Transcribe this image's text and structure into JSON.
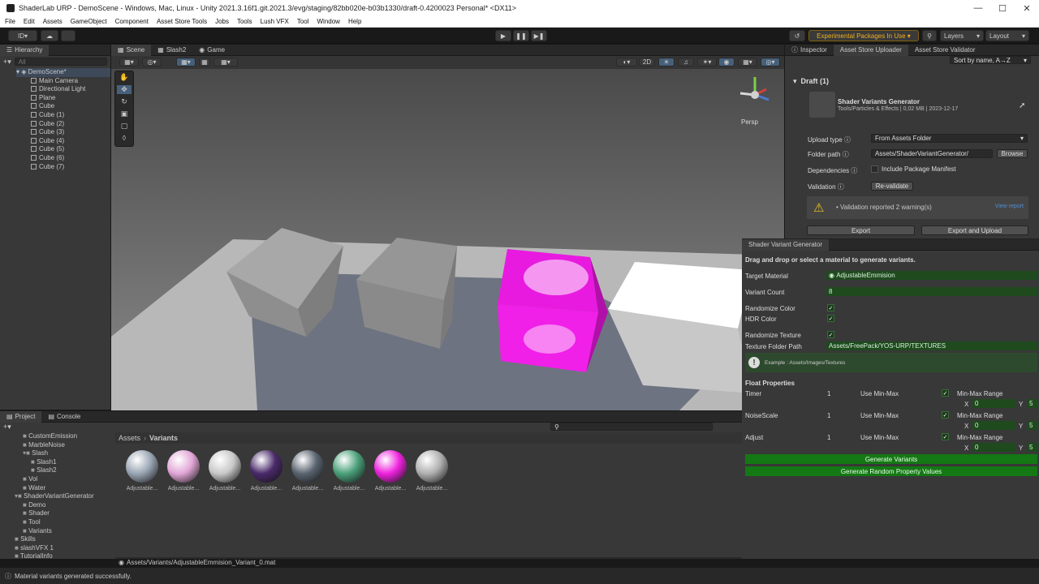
{
  "window": {
    "title": "ShaderLab URP - DemoScene - Windows, Mac, Linux - Unity 2021.3.16f1.git.2021.3/evg/staging/82bb020e-b03b1330/draft-0.4200023 Personal* <DX11>"
  },
  "menu": [
    "File",
    "Edit",
    "Assets",
    "GameObject",
    "Component",
    "Asset Store Tools",
    "Jobs",
    "Tools",
    "Lush VFX",
    "Tool",
    "Window",
    "Help"
  ],
  "toolbar": {
    "account": "ID",
    "packages_label": "Experimental Packages In Use",
    "layers": "Layers",
    "layout": "Layout"
  },
  "hierarchy": {
    "tab": "Hierarchy",
    "search_placeholder": "All",
    "scene": "DemoScene*",
    "items": [
      "Main Camera",
      "Directional Light",
      "Plane",
      "Cube",
      "Cube (1)",
      "Cube (2)",
      "Cube (3)",
      "Cube (4)",
      "Cube (5)",
      "Cube (6)",
      "Cube (7)"
    ]
  },
  "scene_view": {
    "tabs": [
      "Scene",
      "Slash2",
      "Game"
    ],
    "mode_2d": "2D",
    "persp": "Persp"
  },
  "inspector": {
    "tabs": [
      "Inspector",
      "Asset Store Uploader",
      "Asset Store Validator"
    ],
    "sort": "Sort by name, A→Z",
    "draft": "Draft (1)",
    "package_name": "Shader Variants Generator",
    "package_meta": "Tools/Particles & Effects | 0,02 MB | 2023-12-17",
    "upload_type_label": "Upload type",
    "upload_type_value": "From Assets Folder",
    "folder_path_label": "Folder path",
    "folder_path_value": "Assets/ShaderVariantGenerator/",
    "browse": "Browse",
    "dependencies_label": "Dependencies",
    "include_manifest": "Include Package Manifest",
    "validation_label": "Validation",
    "revalidate": "Re-validate",
    "warning_text": "• Validation reported 2 warning(s)",
    "view_report": "View report",
    "export": "Export",
    "export_upload": "Export and Upload"
  },
  "generator": {
    "tab": "Shader Variant Generator",
    "instructions": "Drag and drop or select a material to generate variants.",
    "target_material_label": "Target Material",
    "target_material_value": "AdjustableEmmision",
    "variant_count_label": "Variant Count",
    "variant_count_value": "8",
    "randomize_color_label": "Randomize Color",
    "hdr_color_label": "HDR Color",
    "randomize_texture_label": "Randomize Texture",
    "texture_folder_label": "Texture Folder Path",
    "texture_folder_value": "Assets/FreePack/YOS-URP/TEXTURES",
    "example_hint": "Example : Assets/Images/Textures",
    "float_properties": "Float Properties",
    "floats": [
      {
        "name": "Timer",
        "value": "1",
        "use_minmax": "Use Min-Max",
        "range_label": "Min-Max Range",
        "x": "0",
        "y": "5"
      },
      {
        "name": "NoiseScale",
        "value": "1",
        "use_minmax": "Use Min-Max",
        "range_label": "Min-Max Range",
        "x": "0",
        "y": "5"
      },
      {
        "name": "Adjust",
        "value": "1",
        "use_minmax": "Use Min-Max",
        "range_label": "Min-Max Range",
        "x": "0",
        "y": "5"
      }
    ],
    "generate": "Generate Variants",
    "generate_random": "Generate Random Property Values"
  },
  "project": {
    "tabs": [
      "Project",
      "Console"
    ],
    "breadcrumb": [
      "Assets",
      "Variants"
    ],
    "tree": [
      {
        "label": "CustomEmission",
        "indent": 2
      },
      {
        "label": "MarbleNoise",
        "indent": 2
      },
      {
        "label": "Slash",
        "indent": 2,
        "expanded": true
      },
      {
        "label": "Slash1",
        "indent": 3
      },
      {
        "label": "Slash2",
        "indent": 3
      },
      {
        "label": "Vol",
        "indent": 2
      },
      {
        "label": "Water",
        "indent": 2
      },
      {
        "label": "ShaderVariantGenerator",
        "indent": 1,
        "expanded": true
      },
      {
        "label": "Demo",
        "indent": 2
      },
      {
        "label": "Shader",
        "indent": 2
      },
      {
        "label": "Tool",
        "indent": 2
      },
      {
        "label": "Variants",
        "indent": 2
      },
      {
        "label": "Skills",
        "indent": 1
      },
      {
        "label": "slashVFX 1",
        "indent": 1
      },
      {
        "label": "TutorialInfo",
        "indent": 1
      },
      {
        "label": "Variants",
        "indent": 1
      }
    ],
    "assets": [
      {
        "label": "Adjustable...",
        "color": "#9aa6b4"
      },
      {
        "label": "Adjustable...",
        "color": "#e2a6d6"
      },
      {
        "label": "Adjustable...",
        "color": "#c8c8c8"
      },
      {
        "label": "Adjustable...",
        "color": "#4a2a6a"
      },
      {
        "label": "Adjustable...",
        "color": "#5a6470"
      },
      {
        "label": "Adjustable...",
        "color": "#4aa07a"
      },
      {
        "label": "Adjustable...",
        "color": "#ee22dd"
      },
      {
        "label": "Adjustable...",
        "color": "#b0b0b0"
      }
    ],
    "selected_path": "Assets/Variants/AdjustableEmmision_Variant_0.mat"
  },
  "status": {
    "message": "Material variants generated successfully."
  }
}
